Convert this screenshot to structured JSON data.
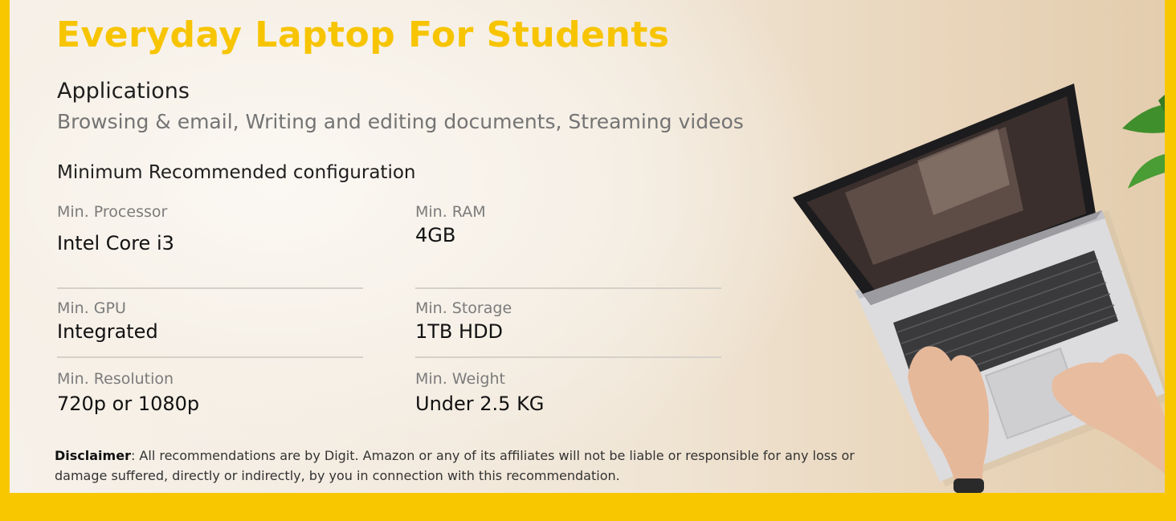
{
  "title": "Everyday Laptop For Students",
  "applications": {
    "heading": "Applications",
    "text": "Browsing & email, Writing and editing documents, Streaming videos"
  },
  "config": {
    "heading": "Minimum Recommended configuration",
    "specs": [
      {
        "label": "Min. Processor",
        "value": "Intel Core i3"
      },
      {
        "label": "Min. RAM",
        "value": "4GB"
      },
      {
        "label": "Min. GPU",
        "value": "Integrated"
      },
      {
        "label": "Min. Storage",
        "value": "1TB HDD"
      },
      {
        "label": "Min. Resolution",
        "value": "720p or 1080p"
      },
      {
        "label": "Min. Weight",
        "value": "Under 2.5 KG"
      }
    ]
  },
  "disclaimer": {
    "label": "Disclaimer",
    "text": ": All recommendations are by Digit. Amazon or any of its affiliates will not be liable or responsible for any loss or damage suffered, directly or indirectly, by you in connection with this recommendation."
  },
  "colors": {
    "brand_yellow": "#f9c700",
    "title_yellow": "#f7c400",
    "background": "#f6f1ea"
  },
  "icons": [
    "laptop-illustration",
    "plant-leaf-illustration"
  ]
}
